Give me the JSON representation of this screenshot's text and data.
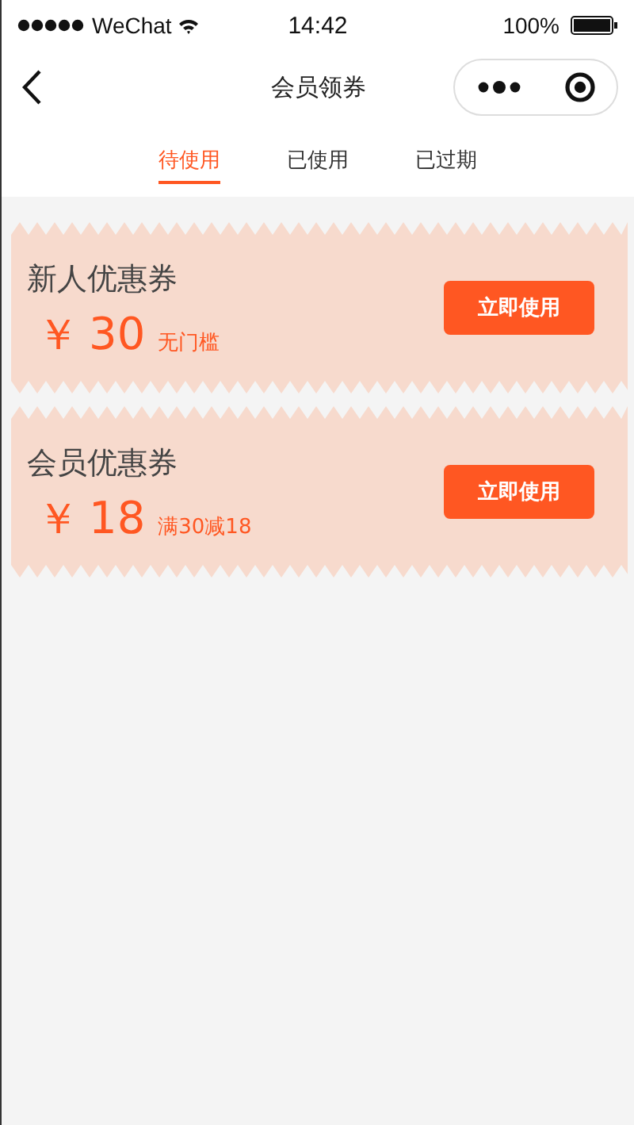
{
  "status_bar": {
    "carrier": "WeChat",
    "time": "14:42",
    "battery": "100%"
  },
  "nav": {
    "title": "会员领券"
  },
  "tabs": [
    {
      "label": "待使用",
      "selected": true
    },
    {
      "label": "已使用",
      "selected": false
    },
    {
      "label": "已过期",
      "selected": false
    }
  ],
  "coupons": [
    {
      "name": "新人优惠券",
      "currency": "￥",
      "amount": "30",
      "condition": "无门槛",
      "button": "立即使用"
    },
    {
      "name": "会员优惠券",
      "currency": "￥",
      "amount": "18",
      "condition": "满30减18",
      "button": "立即使用"
    }
  ]
}
